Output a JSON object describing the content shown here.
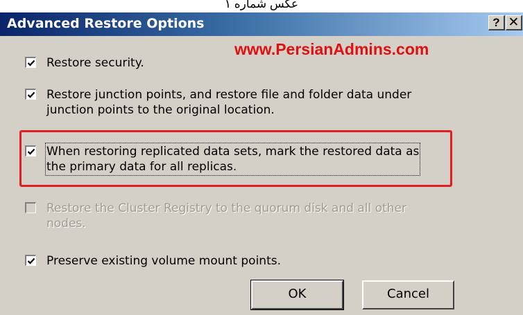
{
  "caption": "عکس شماره ۱",
  "window": {
    "title": "Advanced Restore Options",
    "help_label": "?",
    "close_label": "✕"
  },
  "watermark": "www.PersianAdmins.com",
  "options": [
    {
      "label_line1": "Restore security.",
      "label_line2": "",
      "checked": true,
      "enabled": true
    },
    {
      "label_line1": "Restore junction points, and restore file and folder data under",
      "label_line2": "junction points to the original location.",
      "checked": true,
      "enabled": true
    },
    {
      "label_line1": "When restoring replicated data sets, mark the restored data as",
      "label_line2": "the primary data for all replicas.",
      "checked": true,
      "enabled": true,
      "highlighted": true
    },
    {
      "label_line1": "Restore the Cluster Registry to the quorum disk and all other",
      "label_line2": "nodes.",
      "checked": false,
      "enabled": false
    },
    {
      "label_line1": "Preserve existing volume mount points.",
      "label_line2": "",
      "checked": true,
      "enabled": true
    }
  ],
  "buttons": {
    "ok": "OK",
    "cancel": "Cancel"
  },
  "colors": {
    "title_bar_start": "#0a246a",
    "title_bar_end": "#a6caf0",
    "dialog_bg": "#d4d0c8",
    "highlight_border": "#e02020",
    "watermark": "#e01010"
  }
}
